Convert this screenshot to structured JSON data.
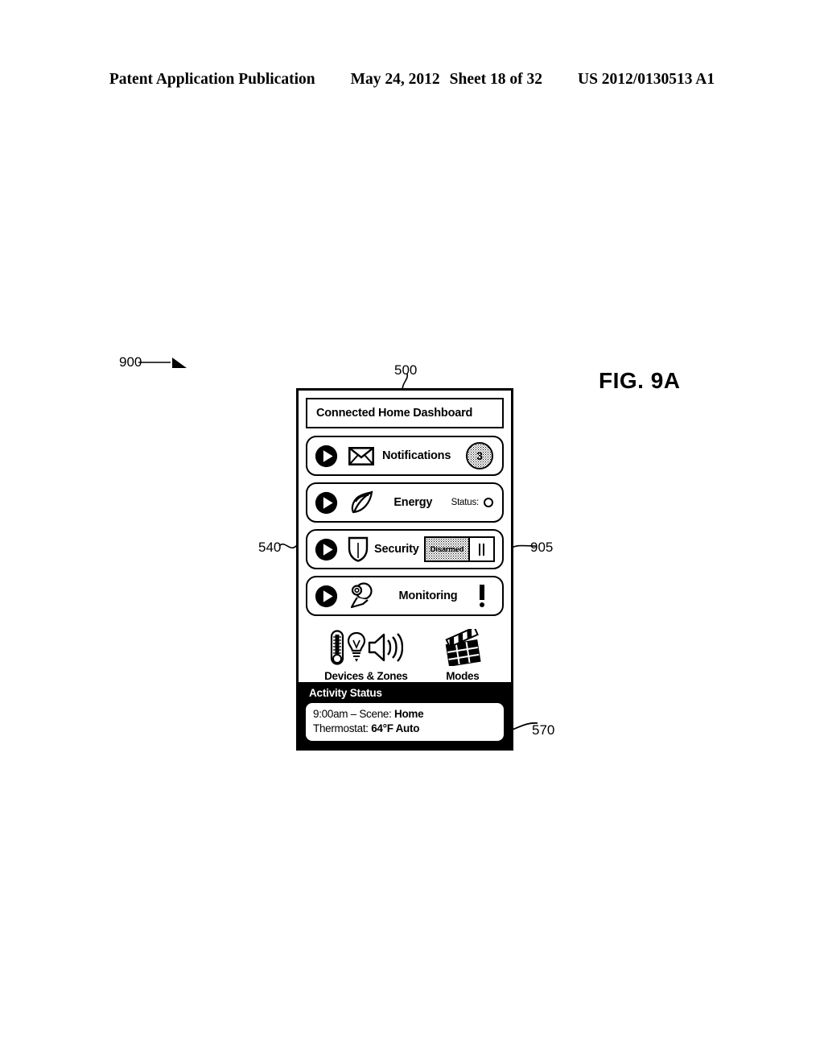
{
  "page_header": {
    "publication": "Patent Application Publication",
    "date": "May 24, 2012",
    "sheet": "Sheet 18 of 32",
    "patent_number": "US 2012/0130513 A1"
  },
  "figure": {
    "label": "FIG. 9A",
    "reference_numerals": {
      "figure": "900",
      "device": "500",
      "security_row": "540",
      "security_toggle": "905",
      "activity_status": "570"
    }
  },
  "dashboard": {
    "title": "Connected Home Dashboard",
    "rows": [
      {
        "label": "Notifications",
        "play_icon": "play-icon",
        "icon": "envelope-icon",
        "badge_count": "3"
      },
      {
        "label": "Energy",
        "play_icon": "play-icon",
        "icon": "leaf-icon",
        "status_label": "Status:",
        "status_indicator": "circle-indicator-icon"
      },
      {
        "label": "Security",
        "play_icon": "play-icon",
        "icon": "shield-icon",
        "toggle_state": "Disarmed",
        "toggle_handle": "grip-handle-icon"
      },
      {
        "label": "Monitoring",
        "play_icon": "play-icon",
        "icon": "camera-icon",
        "alert": "exclamation-icon"
      }
    ],
    "tiles": [
      {
        "label": "Devices & Zones",
        "icons": [
          "thermometer-icon",
          "lightbulb-icon",
          "speaker-icon"
        ]
      },
      {
        "label": "Modes",
        "icons": [
          "clapperboard-icon"
        ]
      }
    ],
    "activity": {
      "header": "Activity Status",
      "line1_prefix": "9:00am – Scene: ",
      "line1_value": "Home",
      "line2_prefix": "Thermostat: ",
      "line2_value": "64°F Auto"
    }
  }
}
